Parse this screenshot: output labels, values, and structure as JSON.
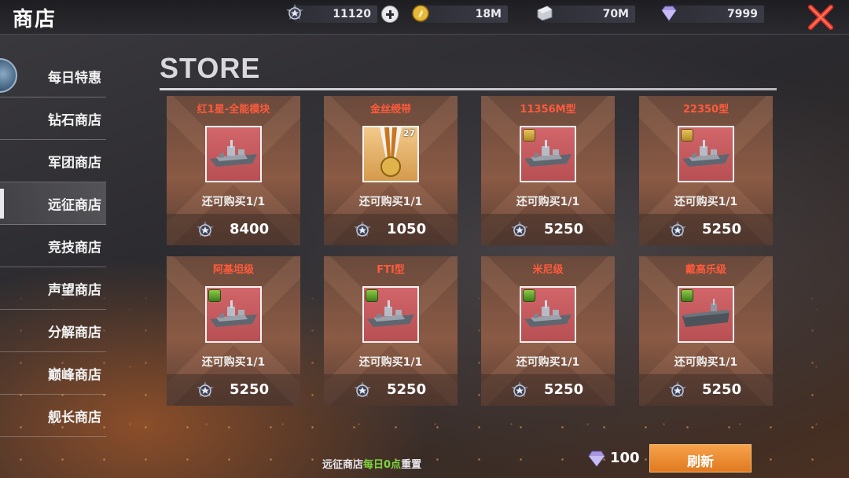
{
  "header": {
    "title": "商店",
    "resources": [
      {
        "name": "expedition-medal",
        "value": "11120"
      },
      {
        "name": "gold-coin",
        "value": "18M"
      },
      {
        "name": "steel",
        "value": "70M"
      },
      {
        "name": "diamond",
        "value": "7999"
      }
    ]
  },
  "sidebar": {
    "items": [
      {
        "label": "每日特惠"
      },
      {
        "label": "钻石商店"
      },
      {
        "label": "军团商店"
      },
      {
        "label": "远征商店",
        "active": true
      },
      {
        "label": "竞技商店"
      },
      {
        "label": "声望商店"
      },
      {
        "label": "分解商店"
      },
      {
        "label": "巅峰商店"
      },
      {
        "label": "舰长商店"
      }
    ]
  },
  "store": {
    "heading": "STORE",
    "items": [
      {
        "name": "红1星-全能模块",
        "remaining": "还可购买1/1",
        "price": "8400",
        "icon": "warship-module-icon"
      },
      {
        "name": "金丝绶带",
        "remaining": "还可购买1/1",
        "price": "1050",
        "icon": "medal-ribbon-icon",
        "count": "27"
      },
      {
        "name": "11356M型",
        "remaining": "还可购买1/1",
        "price": "5250",
        "icon": "frigate-icon"
      },
      {
        "name": "22350型",
        "remaining": "还可购买1/1",
        "price": "5250",
        "icon": "frigate-icon"
      },
      {
        "name": "阿基坦级",
        "remaining": "还可购买1/1",
        "price": "5250",
        "icon": "frigate-icon"
      },
      {
        "name": "FTI型",
        "remaining": "还可购买1/1",
        "price": "5250",
        "icon": "frigate-icon"
      },
      {
        "name": "米尼级",
        "remaining": "还可购买1/1",
        "price": "5250",
        "icon": "destroyer-icon"
      },
      {
        "name": "戴高乐级",
        "remaining": "还可购买1/1",
        "price": "5250",
        "icon": "aircraft-carrier-icon"
      }
    ]
  },
  "footer": {
    "reset_prefix": "远征商店",
    "reset_highlight": "每日0点",
    "reset_suffix": "重置",
    "refresh_cost": "100",
    "refresh_label": "刷新"
  },
  "colors": {
    "item_name": "#ff5a3c",
    "highlight_green": "#7bd63f",
    "refresh_button": "#f2922f",
    "close_x": "#e8322a"
  }
}
